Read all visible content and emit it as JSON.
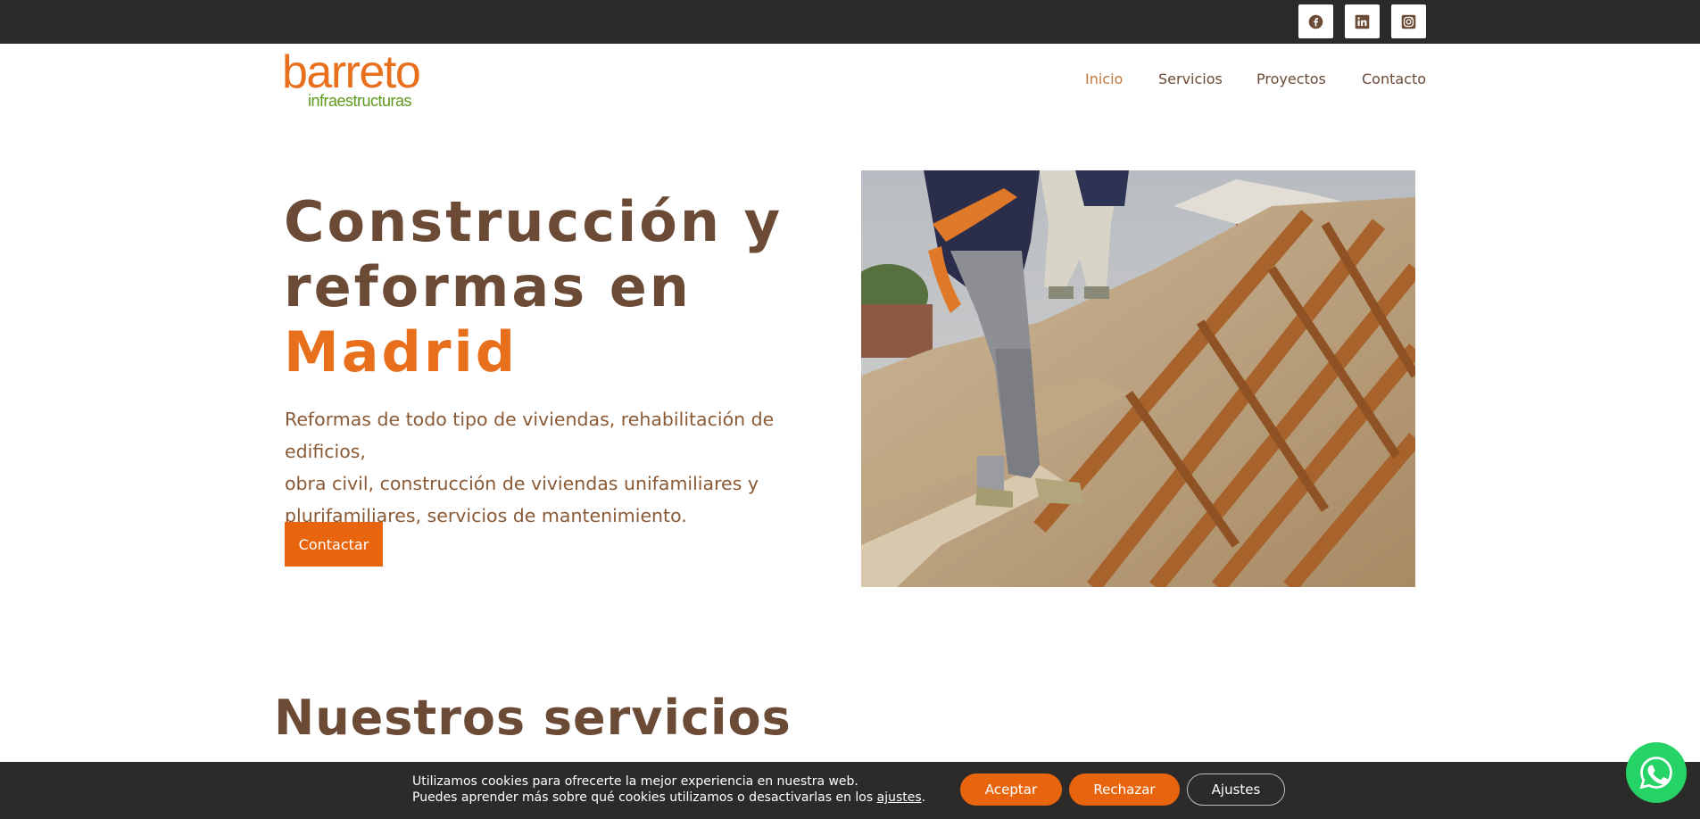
{
  "topbar": {
    "social": [
      {
        "icon": "facebook-icon",
        "label": "Facebook"
      },
      {
        "icon": "linkedin-icon",
        "label": "LinkedIn"
      },
      {
        "icon": "instagram-icon",
        "label": "Instagram"
      }
    ]
  },
  "header": {
    "logo": {
      "main": "barreto",
      "sub": "infraestructuras"
    },
    "nav": [
      {
        "label": "Inicio",
        "active": true
      },
      {
        "label": "Servicios",
        "active": false
      },
      {
        "label": "Proyectos",
        "active": false
      },
      {
        "label": "Contacto",
        "active": false
      }
    ]
  },
  "hero": {
    "title_line1": "Construcción y",
    "title_line2": "reformas en",
    "title_accent": "Madrid",
    "text_line1": "Reformas de todo tipo de viviendas, rehabilitación de edificios,",
    "text_line2": "obra civil, construcción de viviendas unifamiliares y",
    "text_line3": "plurifamiliares, servicios de mantenimiento.",
    "cta_label": "Contactar"
  },
  "services": {
    "title": "Nuestros servicios"
  },
  "cookie": {
    "line1": "Utilizamos cookies para ofrecerte la mejor experiencia en nuestra web.",
    "line2_prefix": "Puedes aprender más sobre qué cookies utilizamos o desactivarlas en los ",
    "line2_link": "ajustes",
    "line2_suffix": ".",
    "accept": "Aceptar",
    "reject": "Rechazar",
    "settings": "Ajustes"
  },
  "colors": {
    "brand_orange": "#e8701c",
    "brand_green": "#5e9a1e",
    "brown_text": "#6b4a36",
    "dark_bar": "#2d2a2a",
    "whatsapp": "#25d366"
  }
}
